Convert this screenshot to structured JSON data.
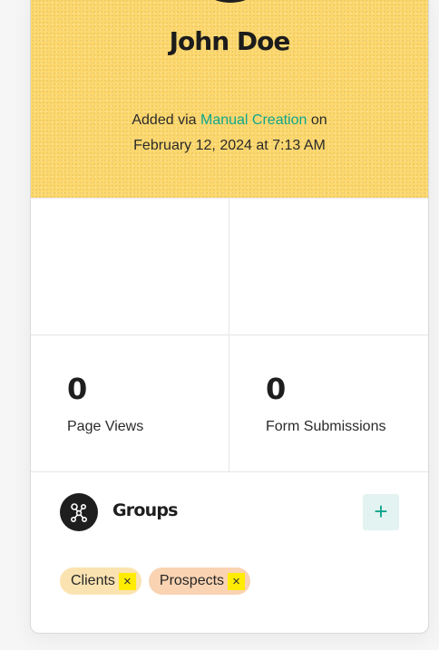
{
  "contact": {
    "name": "John Doe",
    "added_prefix": "Added via",
    "source_link": "Manual Creation",
    "added_suffix": "on",
    "added_date": "February 12, 2024 at 7:13 AM"
  },
  "stats": [
    {
      "value": "0",
      "label": "Page Views"
    },
    {
      "value": "0",
      "label": "Form Submissions"
    }
  ],
  "groups": {
    "title": "Groups",
    "add_label": "+",
    "tags": [
      {
        "label": "Clients",
        "remove": "×"
      },
      {
        "label": "Prospects",
        "remove": "×"
      }
    ]
  },
  "colors": {
    "hero_background": "#fdd86e",
    "accent": "#0ea58b",
    "tag_clients": "#fbe3b1",
    "tag_prospects": "#f9d3b2"
  },
  "icons": {
    "groups": "network-icon",
    "tag_remove": "close-icon",
    "add": "plus-icon"
  }
}
